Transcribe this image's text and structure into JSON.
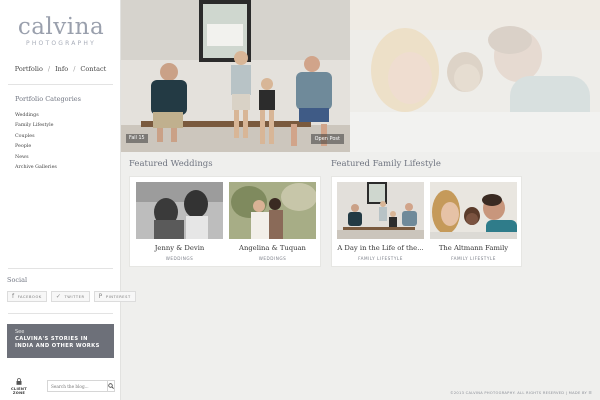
{
  "logo": {
    "main": "calvina",
    "sub": "PHOTOGRAPHY"
  },
  "nav": {
    "portfolio": "Portfolio",
    "info": "Info",
    "contact": "Contact",
    "sep": "/"
  },
  "categories": {
    "title": "Portfolio Categories",
    "items": [
      "Weddings",
      "Family Lifestyle",
      "Couples",
      "People",
      "News",
      "Archive Galleries"
    ]
  },
  "social": {
    "title": "Social",
    "buttons": [
      {
        "label": "FACEBOOK",
        "icon": "facebook-icon",
        "glyph": "f"
      },
      {
        "label": "TWITTER",
        "icon": "twitter-icon",
        "glyph": "✓"
      },
      {
        "label": "PINTEREST",
        "icon": "pinterest-icon",
        "glyph": "P"
      }
    ]
  },
  "see_box": {
    "label": "See",
    "text": "CALVINA'S STORIES IN INDIA AND OTHER WORKS"
  },
  "client_zone": {
    "label": "CLIENT ZONE",
    "icon": "lock-icon"
  },
  "search": {
    "placeholder": "Search the blog...",
    "icon": "search-icon"
  },
  "hero": {
    "left_caption": "Fall 15",
    "open_post": "Open Post"
  },
  "featured_weddings": {
    "title": "Featured Weddings",
    "items": [
      {
        "title": "Jenny & Devin",
        "category": "WEDDINGS"
      },
      {
        "title": "Angelina & Tuquan",
        "category": "WEDDINGS"
      }
    ]
  },
  "featured_family": {
    "title": "Featured Family Lifestyle",
    "items": [
      {
        "title": "A Day in the Life of the...",
        "category": "FAMILY LIFESTYLE"
      },
      {
        "title": "The Altmann Family",
        "category": "FAMILY LIFESTYLE"
      }
    ]
  },
  "footer": {
    "text": "©2013 CALVINA PHOTOGRAPHY. ALL RIGHTS RESERVED | MADE BY ☰"
  },
  "colors": {
    "sidebar_bg": "#ffffff",
    "page_bg": "#efefed",
    "accent": "#6d7079",
    "logo": "#9aa0ad"
  }
}
